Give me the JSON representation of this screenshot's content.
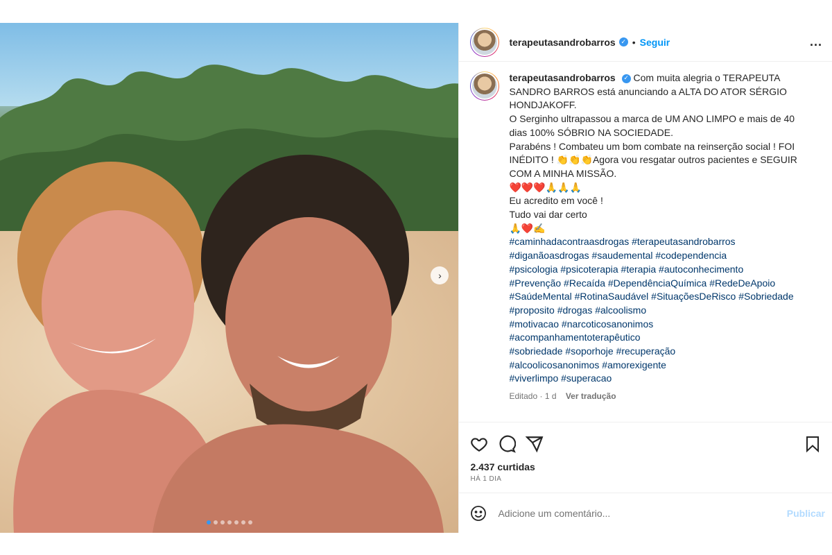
{
  "header": {
    "username": "terapeutasandrobarros",
    "separator": "•",
    "follow_label": "Seguir",
    "more_label": "..."
  },
  "caption": {
    "username": "terapeutasandrobarros",
    "lines": [
      "Com muita alegria o TERAPEUTA SANDRO BARROS está anunciando a ALTA DO ATOR SÉRGIO HONDJAKOFF.",
      "O Serginho ultrapassou a marca de UM ANO LIMPO e mais de 40 dias 100% SÓBRIO NA SOCIEDADE.",
      "Parabéns ! Combateu um bom combate na reinserção social ! FOI INÉDITO ! 👏👏👏Agora vou resgatar outros pacientes e SEGUIR COM A MINHA MISSÃO.",
      "❤️❤️❤️🙏🙏🙏",
      "Eu acredito em você !",
      "Tudo vai dar certo",
      "🙏❤️✍️"
    ],
    "hashtags": [
      "#caminhadacontraasdrogas #terapeutasandrobarros",
      "#diganãoasdrogas #saudemental #codependencia",
      "#psicologia #psicoterapia #terapia #autoconhecimento",
      "#Prevenção #Recaída #DependênciaQuímica #RedeDeApoio",
      "#SaúdeMental #RotinaSaudável #SituaçõesDeRisco #Sobriedade",
      "#proposito #drogas #alcoolismo",
      "#motivacao #narcoticosanonimos",
      "#acompanhamentoterapêutico",
      "#sobriedade #soporhoje #recuperação",
      "#alcoolicosanonimos #amorexigente",
      "#viverlimpo #superacao"
    ],
    "edited": "Editado · 1 d",
    "translate": "Ver tradução"
  },
  "stats": {
    "likes": "2.437 curtidas",
    "date": "HÁ 1 DIA"
  },
  "comment": {
    "placeholder": "Adicione um comentário...",
    "publish": "Publicar"
  },
  "media": {
    "slide_count": 7,
    "active_slide": 1
  },
  "colors": {
    "link_blue": "#0095f6",
    "hashtag": "#00376b",
    "verified_blue": "#3897f0"
  }
}
